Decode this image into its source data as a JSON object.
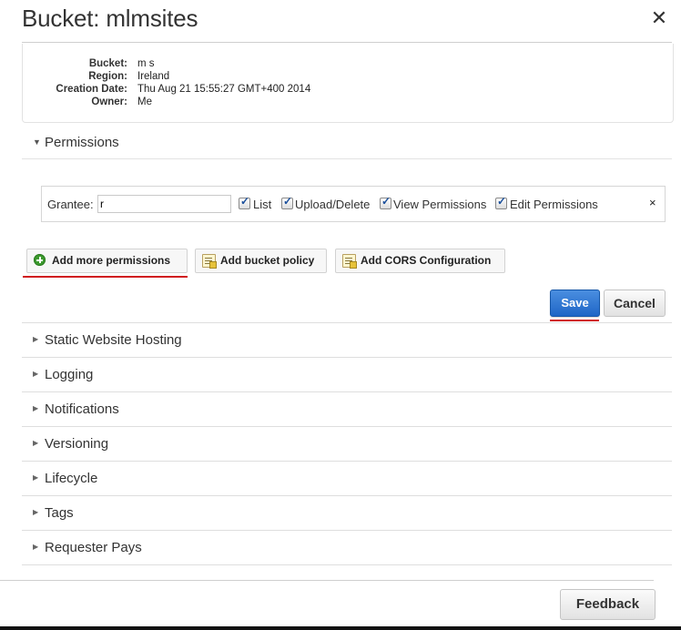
{
  "header": {
    "title": "Bucket: mlmsites",
    "close_glyph": "✕"
  },
  "info": {
    "bucket_label": "Bucket:",
    "bucket_value": "m    s",
    "region_label": "Region:",
    "region_value": "Ireland",
    "creation_label": "Creation Date:",
    "creation_value": "Thu Aug 21 15:55:27 GMT+400 2014",
    "owner_label": "Owner:",
    "owner_value": "Me"
  },
  "permissions": {
    "heading": "Permissions",
    "grantee_label": "Grantee:",
    "grantee_value": "r",
    "checkboxes": [
      {
        "label": "List",
        "checked": true
      },
      {
        "label": "Upload/Delete",
        "checked": true
      },
      {
        "label": "View Permissions",
        "checked": true
      },
      {
        "label": "Edit Permissions",
        "checked": true
      }
    ],
    "remove_glyph": "×"
  },
  "actions": {
    "add_permissions": "Add more permissions",
    "add_bucket_policy": "Add bucket policy",
    "add_cors": "Add CORS Configuration"
  },
  "buttons": {
    "save": "Save",
    "cancel": "Cancel",
    "feedback": "Feedback"
  },
  "sections": [
    {
      "label": "Static Website Hosting"
    },
    {
      "label": "Logging"
    },
    {
      "label": "Notifications"
    },
    {
      "label": "Versioning"
    },
    {
      "label": "Lifecycle"
    },
    {
      "label": "Tags"
    },
    {
      "label": "Requester Pays"
    }
  ],
  "colors": {
    "save_blue": "#1f66c6",
    "annotation_red": "#d0191e"
  },
  "icons": {
    "expanded": "triangle-down-icon",
    "collapsed": "triangle-right-icon",
    "add": "plus-circle-icon",
    "policy": "document-icon"
  }
}
